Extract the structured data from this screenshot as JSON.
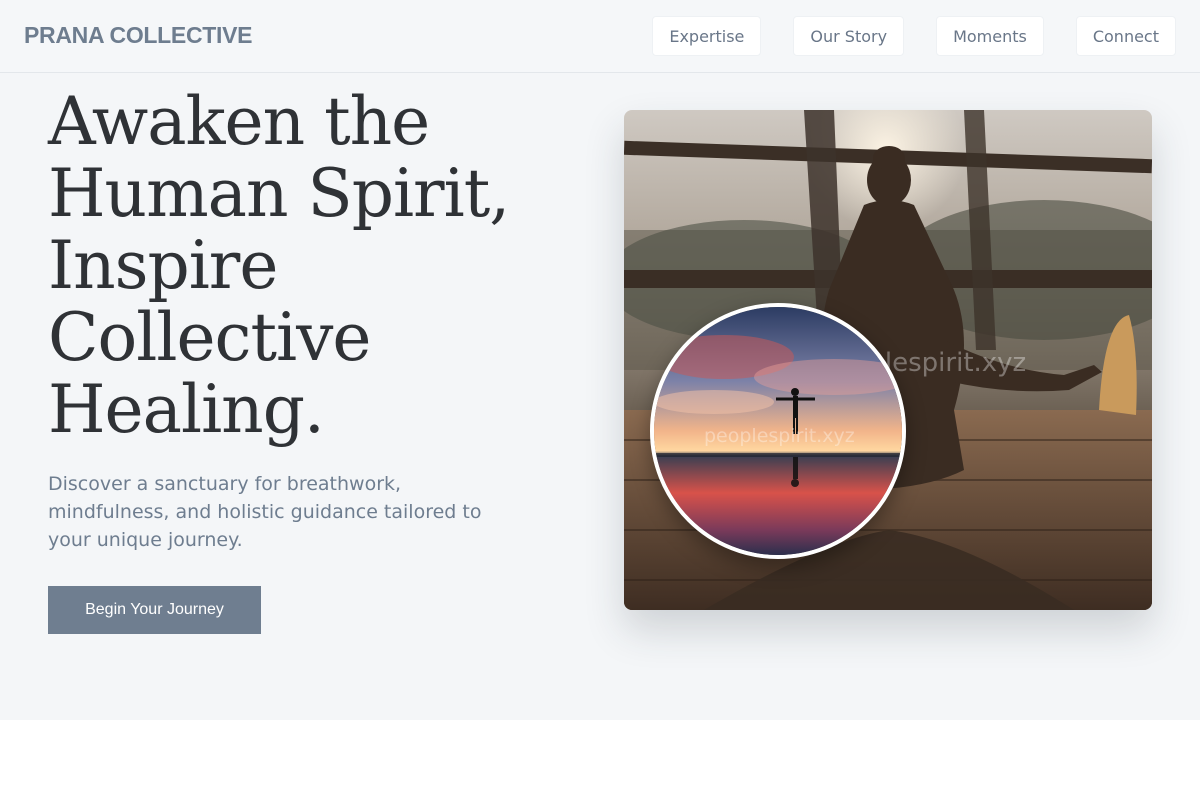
{
  "brand": {
    "name": "PRANA COLLECTIVE"
  },
  "nav": {
    "items": [
      {
        "label": "Expertise"
      },
      {
        "label": "Our Story"
      },
      {
        "label": "Moments"
      },
      {
        "label": "Connect"
      }
    ]
  },
  "hero": {
    "title_lines": [
      "Awaken the",
      "Human Spirit,",
      "Inspire",
      "Collective",
      "Healing."
    ],
    "subtitle": "Discover a sanctuary for breathwork, mindfulness, and holistic guidance tailored to your unique journey.",
    "cta_label": "Begin Your Journey"
  },
  "images": {
    "main_photo": {
      "subject": "woman-meditating-on-wooden-deck",
      "watermark": "peoplespirit.xyz"
    },
    "inset_photo": {
      "subject": "person-arms-outstretched-at-sunset-reflection",
      "watermark": "peoplespirit.xyz"
    }
  },
  "colors": {
    "page_bg": "#f4f6f8",
    "brand_text": "#6e7d8f",
    "cta_bg": "#6f7e90",
    "heading_text": "#2f3236"
  }
}
